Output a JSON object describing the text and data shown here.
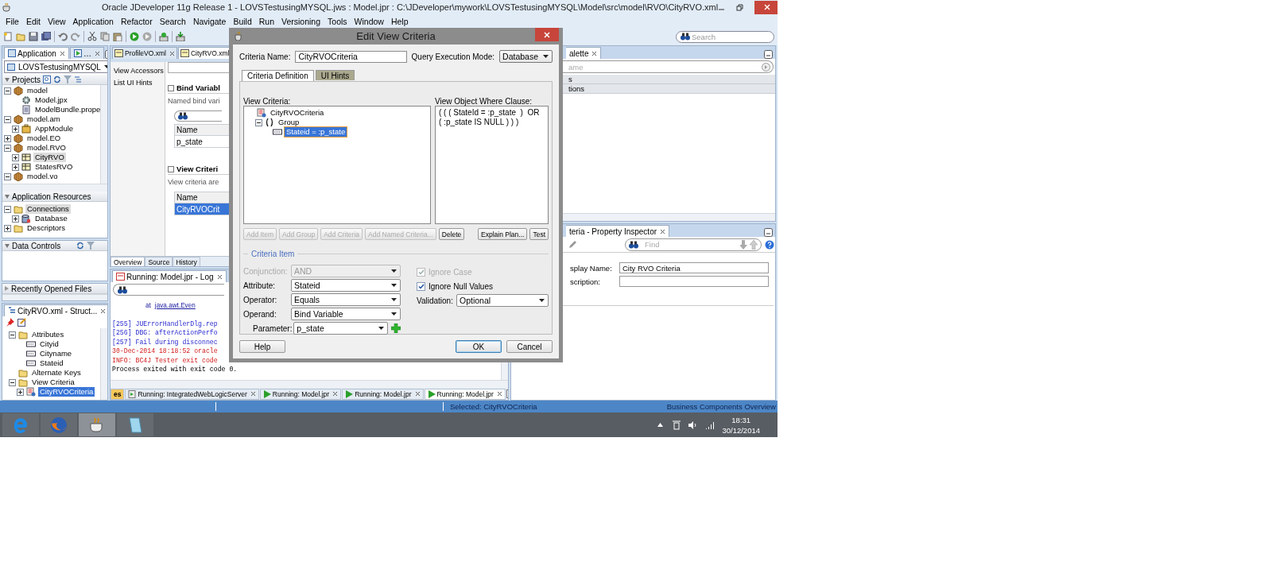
{
  "window": {
    "title": "Oracle JDeveloper 11g Release 1 - LOVSTestusingMYSQL.jws : Model.jpr : C:\\JDeveloper\\mywork\\LOVSTestusingMYSQL\\Model\\src\\model\\RVO\\CityRVO.xml"
  },
  "menu": [
    "File",
    "Edit",
    "View",
    "Application",
    "Refactor",
    "Search",
    "Navigate",
    "Build",
    "Run",
    "Versioning",
    "Tools",
    "Window",
    "Help"
  ],
  "search": {
    "placeholder": "Search"
  },
  "navigator": {
    "tabs": [
      {
        "label": "Application",
        "selected": true
      },
      {
        "label": "…",
        "selected": false
      }
    ],
    "application": "LOVSTestusingMYSQL",
    "projects_title": "Projects",
    "projects": [
      {
        "label": "model",
        "kind": "package",
        "expanded": true,
        "selected": false,
        "children": [
          {
            "label": "Model.jpx",
            "kind": "config",
            "selected": false
          },
          {
            "label": "ModelBundle.prope",
            "kind": "document",
            "selected": false
          }
        ]
      },
      {
        "label": "model.am",
        "kind": "package",
        "expanded": true,
        "selected": false,
        "children": [
          {
            "label": "AppModule",
            "kind": "module",
            "expanded": false,
            "selected": false
          }
        ]
      },
      {
        "label": "model.EO",
        "kind": "package",
        "expanded": false,
        "selected": false
      },
      {
        "label": "model.RVO",
        "kind": "package",
        "expanded": true,
        "selected": false,
        "children": [
          {
            "label": "CityRVO",
            "kind": "viewobject",
            "expanded": false,
            "selected": true
          },
          {
            "label": "StatesRVO",
            "kind": "viewobject",
            "expanded": false,
            "selected": false
          }
        ]
      },
      {
        "label": "model.vo",
        "kind": "package",
        "expanded": true,
        "selected": false
      }
    ],
    "resources_title": "Application Resources",
    "resources": [
      {
        "label": "Connections",
        "kind": "folder",
        "expanded": true,
        "selected": true,
        "children": [
          {
            "label": "Database",
            "kind": "database",
            "expanded": false,
            "selected": false
          }
        ]
      },
      {
        "label": "Descriptors",
        "kind": "folder",
        "expanded": false,
        "selected": false
      }
    ]
  },
  "data_controls": {
    "title": "Data Controls"
  },
  "recent_files": {
    "title": "Recently Opened Files"
  },
  "structure": {
    "tab": "CityRVO.xml - Struct...",
    "tree": [
      {
        "label": "Attributes",
        "kind": "folder",
        "expanded": true,
        "selected": false,
        "children": [
          {
            "label": "Cityid",
            "kind": "attribute",
            "selected": false
          },
          {
            "label": "Cityname",
            "kind": "attribute",
            "selected": false
          },
          {
            "label": "Stateid",
            "kind": "attribute",
            "selected": false
          }
        ]
      },
      {
        "label": "Alternate Keys",
        "kind": "folder",
        "selected": false
      },
      {
        "label": "View Criteria",
        "kind": "folder",
        "expanded": true,
        "selected": false,
        "children": [
          {
            "label": "CityRVOCriteria",
            "kind": "criteria",
            "expanded": false,
            "selected": true
          }
        ]
      }
    ]
  },
  "editor": {
    "tabs": [
      {
        "label": "ProfileVO.xml",
        "selected": false
      },
      {
        "label": "CityRVO.xml",
        "selected": true
      }
    ],
    "nav": [
      "View Accessors",
      "List UI Hints"
    ],
    "sections": [
      {
        "title": "Bind Variabl",
        "description": "Named bind vari",
        "kind": "searchable",
        "column": "Name",
        "rows": [
          {
            "text": "p_state",
            "selected": false
          }
        ]
      },
      {
        "title": "View Criteri",
        "description": "View criteria are",
        "kind": "plain",
        "column": "Name",
        "rows": [
          {
            "text": "CityRVOCrit",
            "selected": true
          }
        ]
      }
    ],
    "bottom_tabs": [
      {
        "label": "Overview",
        "selected": true
      },
      {
        "label": "Source",
        "selected": false
      },
      {
        "label": "History",
        "selected": false
      }
    ]
  },
  "log": {
    "tab": "Running: Model.jpr - Log",
    "lines": [
      {
        "kind": "trace",
        "text": "at",
        "link": "java.awt.Even"
      },
      {
        "kind": "debug",
        "text": "[255] JUErrorHandlerDlg.rep"
      },
      {
        "kind": "debug",
        "text": "[256] DBG: afterActionPerfo"
      },
      {
        "kind": "debug",
        "text": "[257] Fail during disconnec"
      },
      {
        "kind": "error",
        "text": "30-Dec-2014 18:18:52 oracle"
      },
      {
        "kind": "error",
        "text": "INFO: BC4J Tester exit code"
      },
      {
        "kind": "output",
        "text": "Process exited with exit code 0."
      }
    ],
    "tabs": [
      {
        "label": "es",
        "kind": "plain",
        "selected": false
      },
      {
        "label": "Running: IntegratedWebLogicServer",
        "kind": "server",
        "selected": false
      },
      {
        "label": "Running: Model.jpr",
        "kind": "run",
        "selected": false
      },
      {
        "label": "Running: Model.jpr",
        "kind": "run",
        "selected": false
      },
      {
        "label": "Running: Model.jpr",
        "kind": "run",
        "selected": true
      }
    ]
  },
  "palette": {
    "tab": "alette",
    "placeholder": "ame",
    "sections": [
      "s",
      "tions"
    ]
  },
  "inspector": {
    "tab": "teria - Property Inspector",
    "find_placeholder": "Find",
    "fields": [
      {
        "label": "splay Name:",
        "value": "City RVO Criteria"
      },
      {
        "label": "scription:"
      }
    ]
  },
  "status_bar": {
    "selection": "Selected: CityRVOCriteria",
    "view": "Business Components Overview"
  },
  "taskbar": {
    "apps": [
      {
        "kind": "ie",
        "selected": false
      },
      {
        "kind": "firefox",
        "selected": false
      },
      {
        "kind": "jdeveloper",
        "selected": true
      },
      {
        "kind": "notepad",
        "selected": false
      }
    ],
    "time": "18:31",
    "date": "30/12/2014"
  },
  "dialog": {
    "title": "Edit View Criteria",
    "criteria_name": {
      "label": "Criteria Name:",
      "value": "CityRVOCriteria"
    },
    "execution_mode": {
      "label": "Query Execution Mode:",
      "value": "Database"
    },
    "tabs": [
      {
        "label": "Criteria Definition",
        "selected": true
      },
      {
        "label": "UI Hints",
        "selected": false
      }
    ],
    "view_criteria": {
      "label": "View Criteria:",
      "tree": [
        {
          "label": "CityRVOCriteria",
          "kind": "criteria",
          "selected": false,
          "children": [
            {
              "label": "Group",
              "kind": "group",
              "expanded": true,
              "selected": false,
              "children": [
                {
                  "label": "Stateid = :p_state",
                  "kind": "attribute",
                  "selected": true
                }
              ]
            }
          ]
        }
      ]
    },
    "where_clause": {
      "label": "View Object Where Clause:",
      "text": "( ( ( StateId = :p_state  )  OR  ( :p_state IS NULL ) ) )"
    },
    "tree_buttons": [
      {
        "label": "Add Item",
        "disabled": true
      },
      {
        "label": "Add Group",
        "disabled": true
      },
      {
        "label": "Add Criteria",
        "disabled": true
      },
      {
        "label": "Add Named Criteria...",
        "disabled": true
      },
      {
        "label": "Delete",
        "disabled": false
      }
    ],
    "plan_buttons": [
      {
        "label": "Explain Plan..."
      },
      {
        "label": "Test"
      }
    ],
    "group_title": "Criteria Item",
    "fields": [
      {
        "label": "Conjunction:",
        "value": "AND",
        "disabled": true
      },
      {
        "label": "Attribute:",
        "value": "Stateid",
        "disabled": false
      },
      {
        "label": "Operator:",
        "value": "Equals",
        "disabled": false
      },
      {
        "label": "Operand:",
        "value": "Bind Variable",
        "disabled": false
      }
    ],
    "parameter": {
      "label": "Parameter:",
      "value": "p_state"
    },
    "checkboxes": [
      {
        "label": "Ignore Case",
        "checked": true,
        "disabled": true
      },
      {
        "label": "Ignore Null Values",
        "checked": true,
        "disabled": false
      }
    ],
    "validation": {
      "label": "Validation:",
      "value": "Optional"
    },
    "buttons": [
      {
        "label": "Help",
        "default": false
      },
      {
        "label": "OK",
        "default": true
      },
      {
        "label": "Cancel",
        "default": false
      }
    ]
  }
}
